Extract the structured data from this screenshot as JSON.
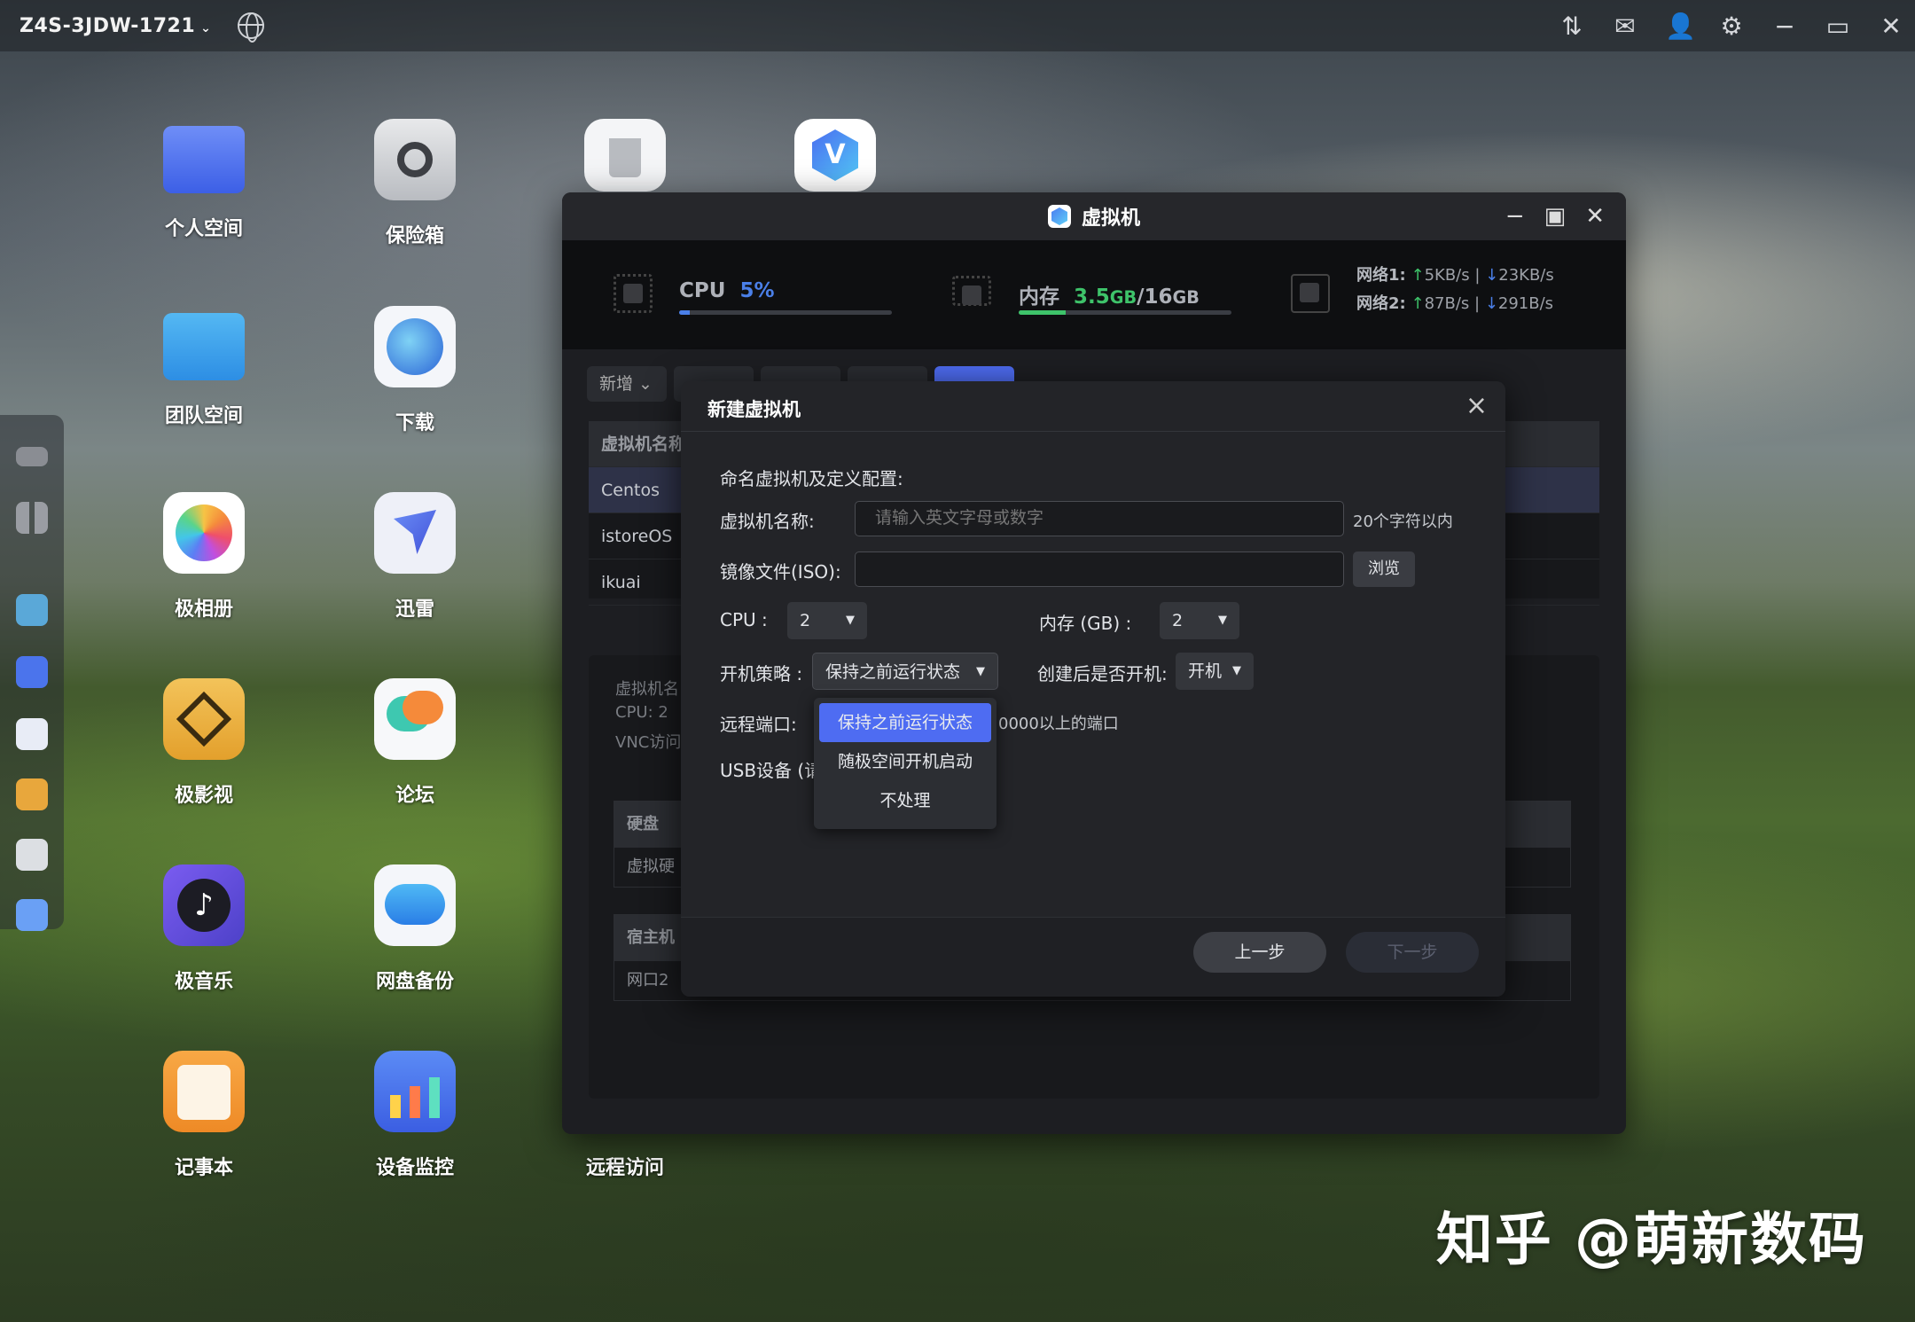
{
  "topbar": {
    "device_name": "Z4S-3JDW-1721",
    "caret": "⌄"
  },
  "desktop_icons": [
    {
      "label": "个人空间",
      "icon": "folder-icon"
    },
    {
      "label": "保险箱",
      "icon": "safe-icon"
    },
    {
      "label": "",
      "icon": "trash-icon"
    },
    {
      "label": "",
      "icon": "vm-app-icon"
    },
    {
      "label": "团队空间",
      "icon": "team-folder-icon"
    },
    {
      "label": "下载",
      "icon": "download-globe-icon"
    },
    {
      "label": "极相册",
      "icon": "photos-icon"
    },
    {
      "label": "迅雷",
      "icon": "thunder-icon"
    },
    {
      "label": "极影视",
      "icon": "video-icon"
    },
    {
      "label": "论坛",
      "icon": "forum-icon"
    },
    {
      "label": "极音乐",
      "icon": "music-icon"
    },
    {
      "label": "网盘备份",
      "icon": "cloud-backup-icon"
    },
    {
      "label": "记事本",
      "icon": "notepad-icon"
    },
    {
      "label": "设备监控",
      "icon": "monitor-chart-icon"
    },
    {
      "label": "远程访问",
      "icon": "remote-access-icon"
    }
  ],
  "vm_window": {
    "title": "虚拟机",
    "cpu": {
      "label": "CPU",
      "value": "5%",
      "percent": 5
    },
    "memory": {
      "label": "内存",
      "used": "3.5",
      "used_unit": "GB",
      "sep": "/",
      "total": "16",
      "total_unit": "GB",
      "percent": 22
    },
    "network": {
      "net1_label": "网络1:",
      "net1_up": "5KB/s",
      "net1_sep": "|",
      "net1_down": "23KB/s",
      "net2_label": "网络2:",
      "net2_up": "87B/s",
      "net2_sep": "|",
      "net2_down": "291B/s"
    },
    "toolbar_new": "新增 ⌄",
    "table": {
      "header": "虚拟机名称",
      "rows": [
        "Centos",
        "istoreOS",
        "ikuai"
      ]
    },
    "detail": {
      "line1": "虚拟机名",
      "line2": "CPU: 2",
      "line3": "VNC访问",
      "disk_header": "硬盘",
      "disk_row": "虚拟硬",
      "host_header": "宿主机",
      "host_row": "网口2"
    }
  },
  "dialog": {
    "title": "新建虚拟机",
    "section": "命名虚拟机及定义配置:",
    "name_label": "虚拟机名称:",
    "name_placeholder": "请输入英文字母或数字",
    "name_hint": "20个字符以内",
    "iso_label": "镜像文件(ISO):",
    "browse": "浏览",
    "cpu_label": "CPU :",
    "cpu_value": "2",
    "mem_label": "内存 (GB) :",
    "mem_value": "2",
    "boot_label": "开机策略 :",
    "boot_value": "保持之前运行状态",
    "poweron_label": "创建后是否开机:",
    "poweron_value": "开机",
    "remote_label": "远程端口:",
    "remote_hint": "0000以上的端口",
    "usb_label": "USB设备 (请",
    "dropdown_options": [
      "保持之前运行状态",
      "随极空间开机启动",
      "不处理"
    ],
    "prev": "上一步",
    "next": "下一步"
  },
  "watermark": "知乎 @萌新数码",
  "colors": {
    "accent": "#4e6cf2",
    "cpu_bar": "#4a7fe8",
    "mem_bar": "#3ec36a"
  }
}
